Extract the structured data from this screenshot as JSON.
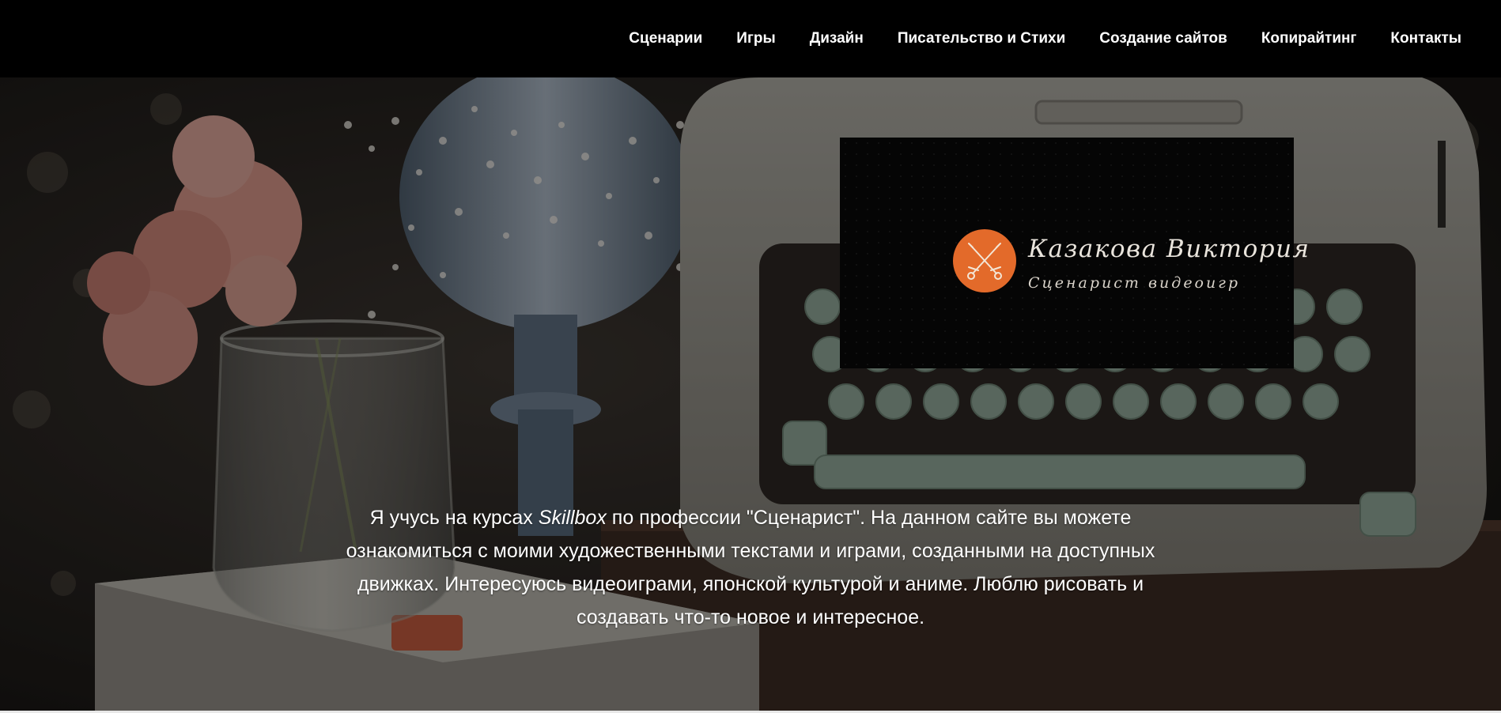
{
  "nav": {
    "items": [
      {
        "label": "Сценарии"
      },
      {
        "label": "Игры"
      },
      {
        "label": "Дизайн"
      },
      {
        "label": "Писательство и Стихи"
      },
      {
        "label": "Создание сайтов"
      },
      {
        "label": "Копирайтинг"
      },
      {
        "label": "Контакты"
      }
    ]
  },
  "logo": {
    "name": "Казакова Виктория",
    "subtitle": "Сценарист видеоигр",
    "icon": "crossed-swords-icon",
    "circle_color": "#e36a2a"
  },
  "intro": {
    "before_brand": "Я учусь на курсах ",
    "brand": "Skillbox",
    "after_brand": " по профессии \"Сценарист\". На данном сайте вы можете ознакомиться с моими художественными текстами и играми, созданными на доступных движках. Интересуюсь видеоиграми, японской культурой и аниме. Люблю рисовать и создавать что-то новое и интересное."
  },
  "colors": {
    "nav_background": "#000000",
    "nav_text": "#ffffff",
    "accent_orange": "#e36a2a"
  }
}
